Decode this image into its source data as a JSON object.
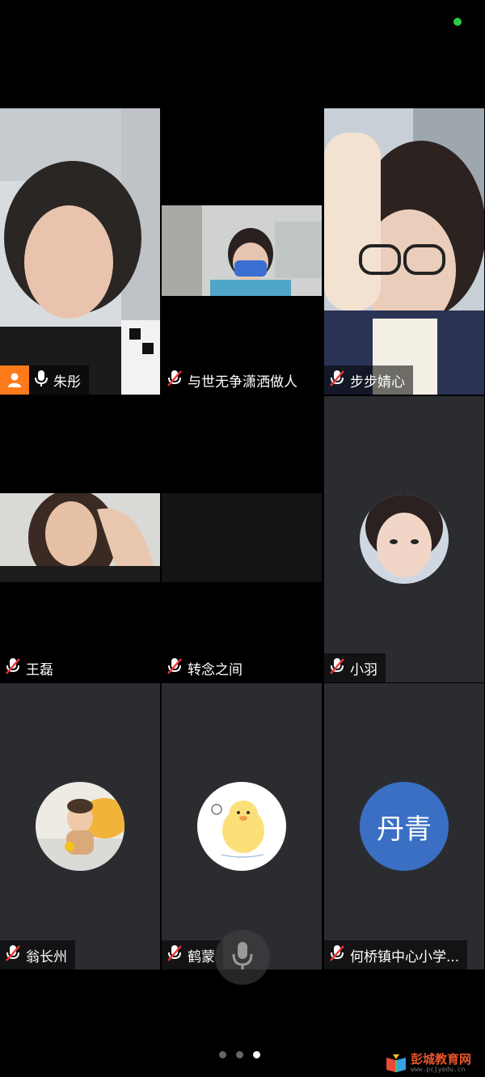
{
  "participants": [
    {
      "name": "朱彤",
      "muted": false,
      "host": true
    },
    {
      "name": "与世无争潇洒做人",
      "muted": true
    },
    {
      "name": "步步婧心",
      "muted": true
    },
    {
      "name": "王磊",
      "muted": true
    },
    {
      "name": "转念之间",
      "muted": true
    },
    {
      "name": "小羽",
      "muted": true
    },
    {
      "name": "翁长州",
      "muted": true
    },
    {
      "name": "鹤蒙",
      "muted": true
    },
    {
      "name": "何桥镇中心小学...",
      "muted": true,
      "avatar_text": "丹青"
    }
  ],
  "pagination": {
    "total": 3,
    "current": 3
  },
  "watermark": {
    "title": "彭城教育网",
    "url": "www.pcjyedu.cn"
  },
  "colors": {
    "host_badge": "#ff7a1a",
    "avatar_blue": "#3a6fc4",
    "status_dot": "#2ecc40"
  }
}
